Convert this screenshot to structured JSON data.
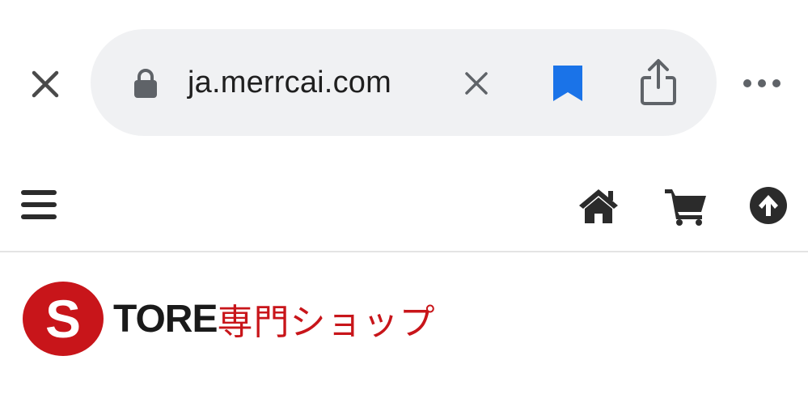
{
  "browser": {
    "url": "ja.merrcai.com",
    "icons": {
      "close": "close-icon",
      "lock": "lock-icon",
      "clear": "clear-url-icon",
      "bookmark": "bookmark-icon",
      "share": "share-icon",
      "more": "more-icon"
    },
    "colors": {
      "pill_bg": "#f0f1f3",
      "bookmark": "#1a73e8",
      "icon": "#5f6368"
    }
  },
  "site_nav": {
    "icons": {
      "menu": "hamburger-menu-icon",
      "home": "home-icon",
      "cart": "cart-icon",
      "up": "arrow-up-circle-icon"
    },
    "colors": {
      "icon": "#2b2b2b"
    }
  },
  "logo": {
    "initial": "S",
    "rest": "TORE",
    "japanese": "専門ショップ",
    "colors": {
      "red": "#c8151a",
      "dark": "#1a1a1a"
    }
  }
}
